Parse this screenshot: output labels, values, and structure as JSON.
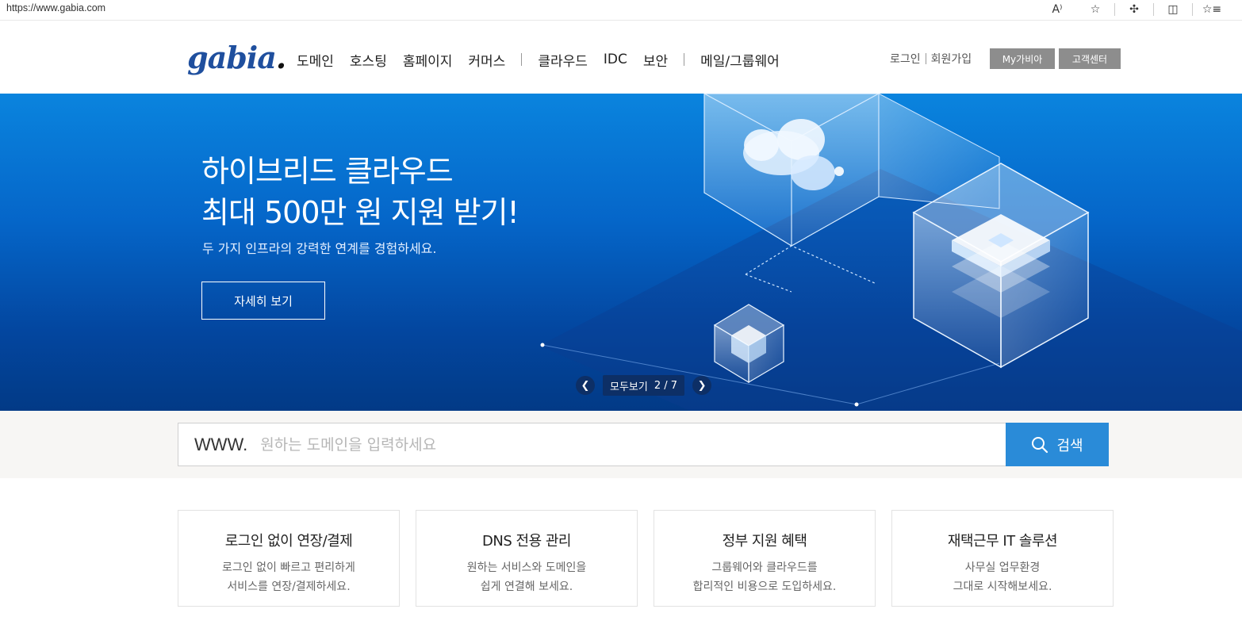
{
  "browser": {
    "url": "https://www.gabia.com",
    "icons": [
      "read-aloud-icon",
      "favorite-star-icon",
      "extensions-icon",
      "split-screen-icon",
      "favorites-list-icon"
    ],
    "read_aloud_glyph": "A⁾"
  },
  "header": {
    "logo_text": "gabia",
    "logo_dot": ".",
    "nav": [
      "도메인",
      "호스팅",
      "홈페이지",
      "커머스",
      "클라우드",
      "IDC",
      "보안",
      "메일/그룹웨어"
    ],
    "login": "로그인",
    "signup": "회원가입",
    "my_gabia": "My가비아",
    "customer_center": "고객센터"
  },
  "hero": {
    "title_line1": "하이브리드 클라우드",
    "title_line2": "최대 500만 원 지원 받기!",
    "subtitle": "두 가지 인프라의 강력한 연계를 경험하세요.",
    "button": "자세히 보기",
    "view_all": "모두보기",
    "page": "2 / 7",
    "colors": {
      "top": "#0a84de",
      "bottom": "#023a86"
    }
  },
  "search": {
    "prefix": "WWW.",
    "placeholder": "원하는 도메인을 입력하세요",
    "value": "",
    "button": "검색",
    "button_color": "#2a8bd8"
  },
  "cards": [
    {
      "title": "로그인 없이 연장/결제",
      "desc": "로그인 없이 빠르고 편리하게\n서비스를 연장/결제하세요."
    },
    {
      "title": "DNS 전용 관리",
      "desc": "원하는 서비스와 도메인을\n쉽게 연결해 보세요."
    },
    {
      "title": "정부 지원 혜택",
      "desc": "그룹웨어와 클라우드를\n합리적인 비용으로 도입하세요."
    },
    {
      "title": "재택근무 IT 솔루션",
      "desc": "사무실 업무환경\n그대로 시작해보세요."
    }
  ]
}
